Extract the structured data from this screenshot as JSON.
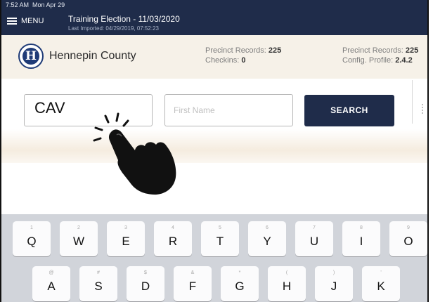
{
  "status_bar": {
    "time": "7:52 AM",
    "date": "Mon Apr 29"
  },
  "nav": {
    "menu_label": "MENU",
    "election_title": "Training Election - 11/03/2020",
    "last_imported": "Last Imported: 04/29/2019, 07:52:23"
  },
  "header": {
    "logo_letter": "H",
    "county_name": "Hennepin County",
    "precinct_records_label": "Precinct Records:",
    "precinct_records_value": "225",
    "checkins_label": "Checkins:",
    "checkins_value": "0",
    "precinct_records_label_2": "Precinct Records:",
    "precinct_records_value_2": "225",
    "config_profile_label": "Config. Profile:",
    "config_profile_value": "2.4.2"
  },
  "search": {
    "last_name_value": "CAV",
    "first_name_placeholder": "First Name",
    "search_button_label": "SEARCH"
  },
  "keyboard": {
    "row1": [
      {
        "key": "Q",
        "hint": "1"
      },
      {
        "key": "W",
        "hint": "2"
      },
      {
        "key": "E",
        "hint": "3"
      },
      {
        "key": "R",
        "hint": "4"
      },
      {
        "key": "T",
        "hint": "5"
      },
      {
        "key": "Y",
        "hint": "6"
      },
      {
        "key": "U",
        "hint": "7"
      },
      {
        "key": "I",
        "hint": "8"
      },
      {
        "key": "O",
        "hint": "9"
      }
    ],
    "row2": [
      {
        "key": "A",
        "hint": "@"
      },
      {
        "key": "S",
        "hint": "#"
      },
      {
        "key": "D",
        "hint": "$"
      },
      {
        "key": "F",
        "hint": "&"
      },
      {
        "key": "G",
        "hint": "*"
      },
      {
        "key": "H",
        "hint": "("
      },
      {
        "key": "J",
        "hint": ")"
      },
      {
        "key": "K",
        "hint": "'"
      }
    ]
  },
  "colors": {
    "nav_bg": "#1f2c4a",
    "logo_blue": "#1f3b77",
    "search_button": "#1f2c4a"
  }
}
